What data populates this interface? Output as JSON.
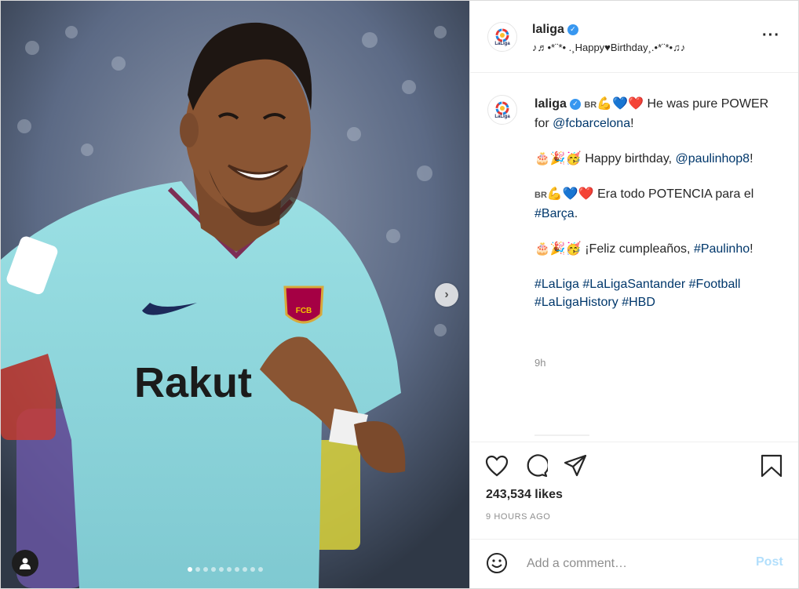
{
  "post": {
    "carousel": {
      "slide_count": 10,
      "active_index": 0
    }
  },
  "jersey": {
    "sponsor_text": "Rakut",
    "badge_text": "FCB"
  },
  "account": {
    "username": "laliga",
    "logo_label": "LaLiga",
    "verified_icon": "verified-badge-icon",
    "audio_text": "♪♬•*¨*• .¸Happy♥Birthday¸.•*¨*•♫♪"
  },
  "caption": {
    "username": "laliga",
    "line1_prefix": "BR",
    "line1_text": " He was pure POWER for ",
    "line1_mention": "@fcbarcelona",
    "line1_end": "!",
    "line2_text": " Happy birthday, ",
    "line2_mention": "@paulinhop8",
    "line2_end": "!",
    "line3_prefix": "BR",
    "line3_text": " Era todo POTENCIA para el ",
    "line3_tag": "#Barça",
    "line3_end": ".",
    "line4_text": " ¡Feliz cumpleaños, ",
    "line4_tag": "#Paulinho",
    "line4_end": "!",
    "hashtags": [
      "#LaLiga",
      "#LaLigaSantander",
      "#Football",
      "#LaLigaHistory",
      "#HBD"
    ],
    "time": "9h"
  },
  "actions": {
    "likes": "243,534 likes",
    "posted_ago": "9 HOURS AGO"
  },
  "comment": {
    "placeholder": "Add a comment…",
    "post_label": "Post"
  },
  "colors": {
    "link": "#00376b",
    "verified": "#3897f0",
    "post_button": "#b2dffc",
    "jersey": "#8fd6dc"
  }
}
